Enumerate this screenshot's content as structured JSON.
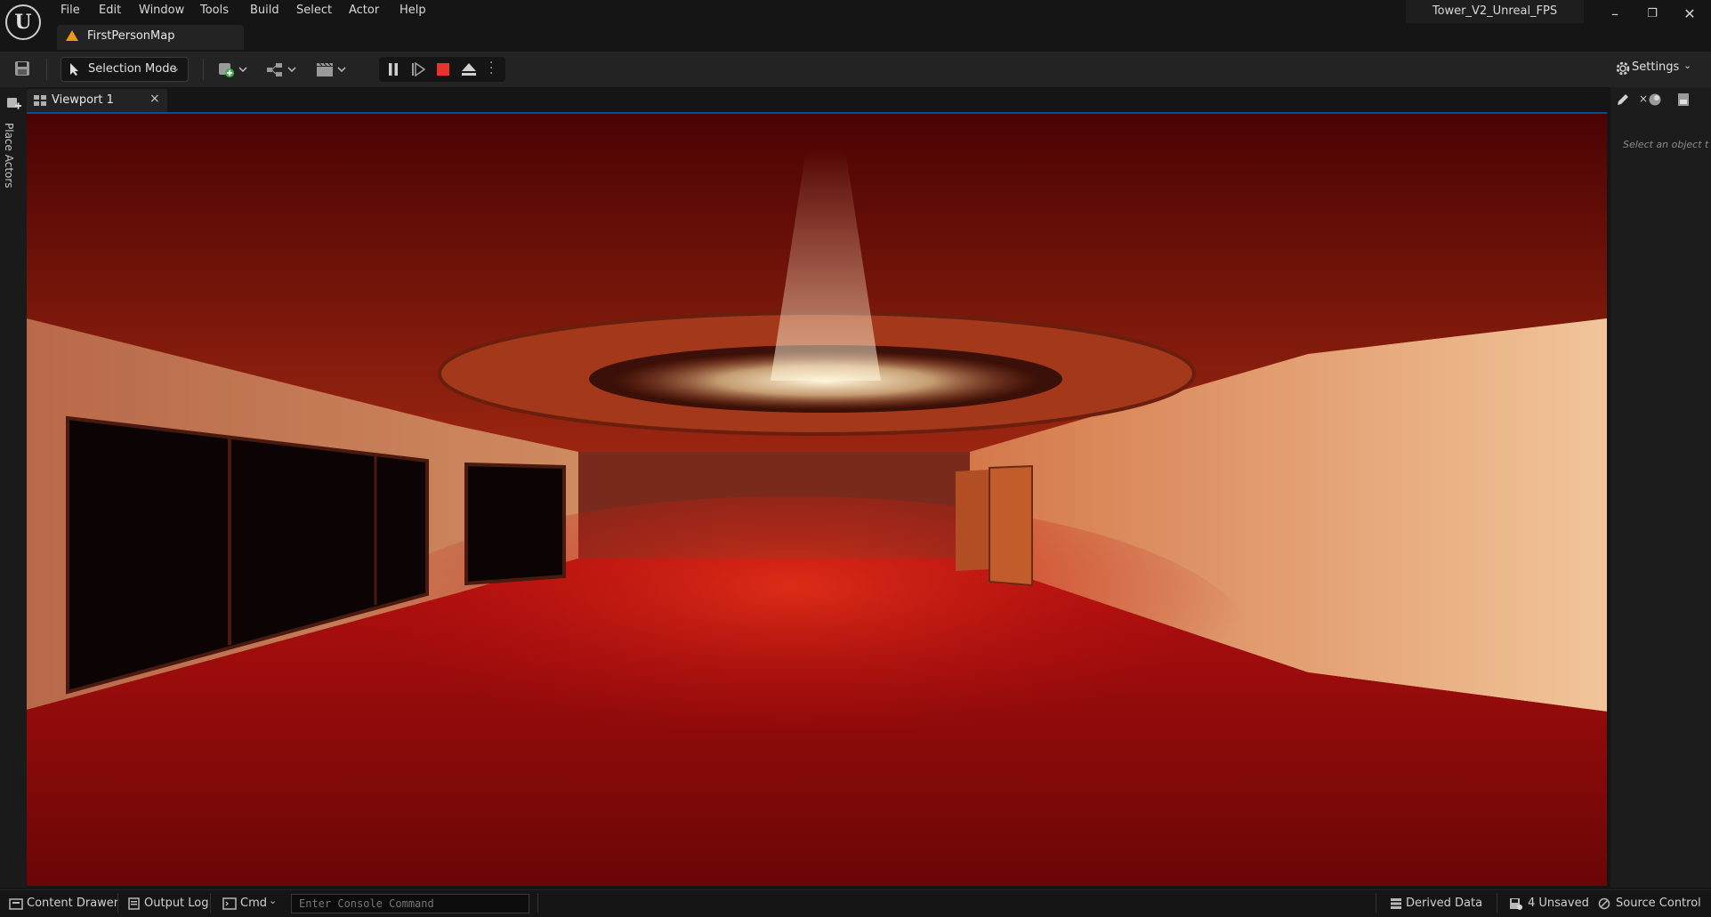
{
  "menu": {
    "items": [
      "File",
      "Edit",
      "Window",
      "Tools",
      "Build",
      "Select",
      "Actor",
      "Help"
    ]
  },
  "map_tab": {
    "label": "FirstPersonMap",
    "icon": "warning-icon"
  },
  "project": {
    "name": "Tower_V2_Unreal_FPS"
  },
  "window_controls": {
    "minimize": "–",
    "restore": "❐",
    "close": "✕"
  },
  "toolbar": {
    "save_icon": "save-icon",
    "selection_mode_label": "Selection Mode",
    "settings_label": "Settings"
  },
  "left_panel": {
    "place_actors_label": "Place Actors"
  },
  "viewport": {
    "tab_label": "Viewport 1",
    "close_glyph": "×"
  },
  "details": {
    "hint": "Select an object t"
  },
  "bottom": {
    "content_drawer": "Content Drawer",
    "output_log": "Output Log",
    "cmd": "Cmd",
    "console_placeholder": "Enter Console Command",
    "derived_data": "Derived Data",
    "unsaved": "4 Unsaved",
    "source_control": "Source Control"
  },
  "colors": {
    "accent": "#0a4e8a",
    "stop": "#e8332e",
    "warning": "#e69a1f",
    "scene_red": "#a40f0f"
  }
}
